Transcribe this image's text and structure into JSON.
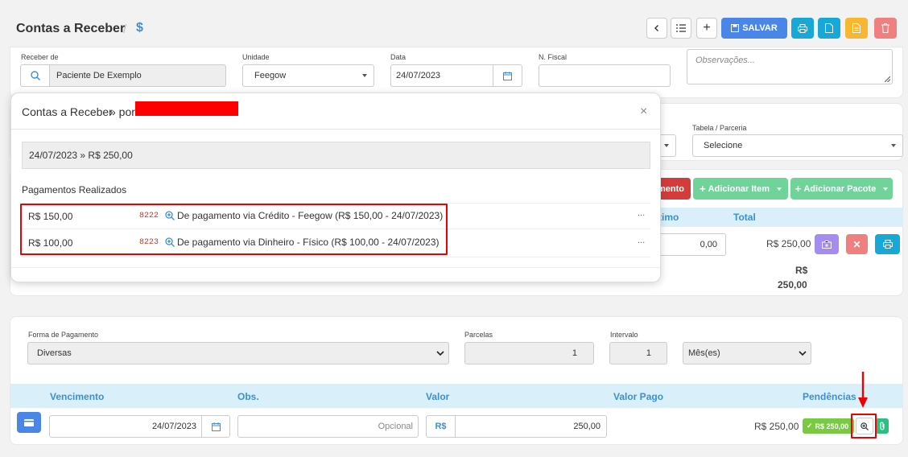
{
  "page": {
    "title": "Contas a Receber",
    "title_icon": "dollar-icon"
  },
  "toolbar": {
    "save_label": "SALVAR"
  },
  "form": {
    "receber_de_label": "Receber de",
    "receber_de_value": "Paciente De Exemplo",
    "unidade_label": "Unidade",
    "unidade_value": "Feegow",
    "data_label": "Data",
    "data_value": "24/07/2023",
    "nfiscal_label": "N. Fiscal",
    "nfiscal_value": "",
    "observacoes_placeholder": "Observações...",
    "tabela_label": "Tabela / Parceria",
    "tabela_value": "Selecione"
  },
  "items": {
    "btn_pagamento_partial": "mento",
    "btn_adicionar_item": "Adicionar Item",
    "btn_adicionar_pacote": "Adicionar Pacote",
    "col_partial": "timo",
    "col_total": "Total",
    "row_value": "0,00",
    "row_total": "R$ 250,00",
    "sum_currency": "R$",
    "sum_value": "250,00"
  },
  "modal": {
    "title": "Contas a Receber",
    "title_suffix": "» por",
    "summary": "24/07/2023 » R$ 250,00",
    "section_title": "Pagamentos Realizados",
    "payments": [
      {
        "amount": "R$ 150,00",
        "code": "8222",
        "desc": "De pagamento via Crédito - Feegow (R$ 150,00 - 24/07/2023)",
        "more": "..."
      },
      {
        "amount": "R$ 100,00",
        "code": "8223",
        "desc": "De pagamento via Dinheiro - Físico (R$ 100,00 - 24/07/2023)",
        "more": "..."
      }
    ]
  },
  "payment": {
    "forma_label": "Forma de Pagamento",
    "forma_value": "Diversas",
    "parcelas_label": "Parcelas",
    "parcelas_value": "1",
    "intervalo_label": "Intervalo",
    "intervalo_value": "1",
    "periodo_value": "Mês(es)",
    "col_vencimento": "Vencimento",
    "col_obs": "Obs.",
    "col_valor": "Valor",
    "col_valor_pago": "Valor Pago",
    "col_pendencias": "Pendências",
    "row_date": "24/07/2023",
    "row_obs_placeholder": "Opcional",
    "row_currency": "R$",
    "row_valor": "250,00",
    "row_valor_pago": "R$ 250,00",
    "row_badge": "R$ 250,00"
  },
  "colors": {
    "accent": "#3b8fd6",
    "save": "#4a86e8",
    "green": "#70d49a",
    "red": "#e00000"
  }
}
